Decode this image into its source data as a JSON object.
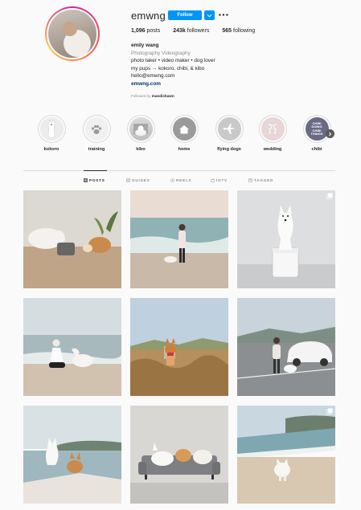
{
  "profile": {
    "username": "emwng",
    "follow_label": "Follow",
    "stats": {
      "posts_count": "1,096",
      "posts_label": "posts",
      "followers_count": "243k",
      "followers_label": "followers",
      "following_count": "565",
      "following_label": "following"
    },
    "bio": {
      "name": "emily wang",
      "category": "Photography Videography",
      "line1": "photo taker • video maker • dog lover",
      "line2": "my pups → kokoro, chibi, & kibo",
      "email": "hello@emwng.com",
      "link": "emwng.com"
    },
    "followed_by_prefix": "Followed by",
    "followed_by_user": "mandishawn"
  },
  "highlights": [
    {
      "label": "kokoro",
      "icon": "dog-photo"
    },
    {
      "label": "training",
      "icon": "paw-icon"
    },
    {
      "label": "kibo",
      "icon": "dog-photo"
    },
    {
      "label": "home",
      "icon": "house-icon"
    },
    {
      "label": "flying dogs",
      "icon": "airplane-icon"
    },
    {
      "label": "wedding",
      "icon": "champagne-icon"
    },
    {
      "label": "chibi",
      "icon": "text-cover",
      "cover_text": "CHIBI DOING CHIBI THINGS"
    }
  ],
  "tabs": [
    {
      "label": "POSTS",
      "icon": "grid-icon",
      "active": true
    },
    {
      "label": "GUIDES",
      "icon": "guides-icon",
      "active": false
    },
    {
      "label": "REELS",
      "icon": "reels-icon",
      "active": false
    },
    {
      "label": "IGTV",
      "icon": "igtv-icon",
      "active": false
    },
    {
      "label": "TAGGED",
      "icon": "tagged-icon",
      "active": false
    }
  ],
  "posts": [
    {
      "subject": "white dog and corgi drinking from fountain",
      "multi": false
    },
    {
      "subject": "woman walking with white dog on beach",
      "multi": false
    },
    {
      "subject": "white dog sitting on cooler",
      "multi": true
    },
    {
      "subject": "woman crouching with white dog on beach",
      "multi": false
    },
    {
      "subject": "corgi in golden grass field",
      "multi": false
    },
    {
      "subject": "woman and white dog by white car",
      "multi": false
    },
    {
      "subject": "white dog and corgi on boat",
      "multi": false
    },
    {
      "subject": "three dogs on grey sofa",
      "multi": false
    },
    {
      "subject": "white dog running on beach",
      "multi": true
    }
  ],
  "colors": {
    "accent": "#0095f6",
    "text": "#262626",
    "muted": "#8e8e8e",
    "link": "#00376b",
    "background": "#fafafa"
  }
}
